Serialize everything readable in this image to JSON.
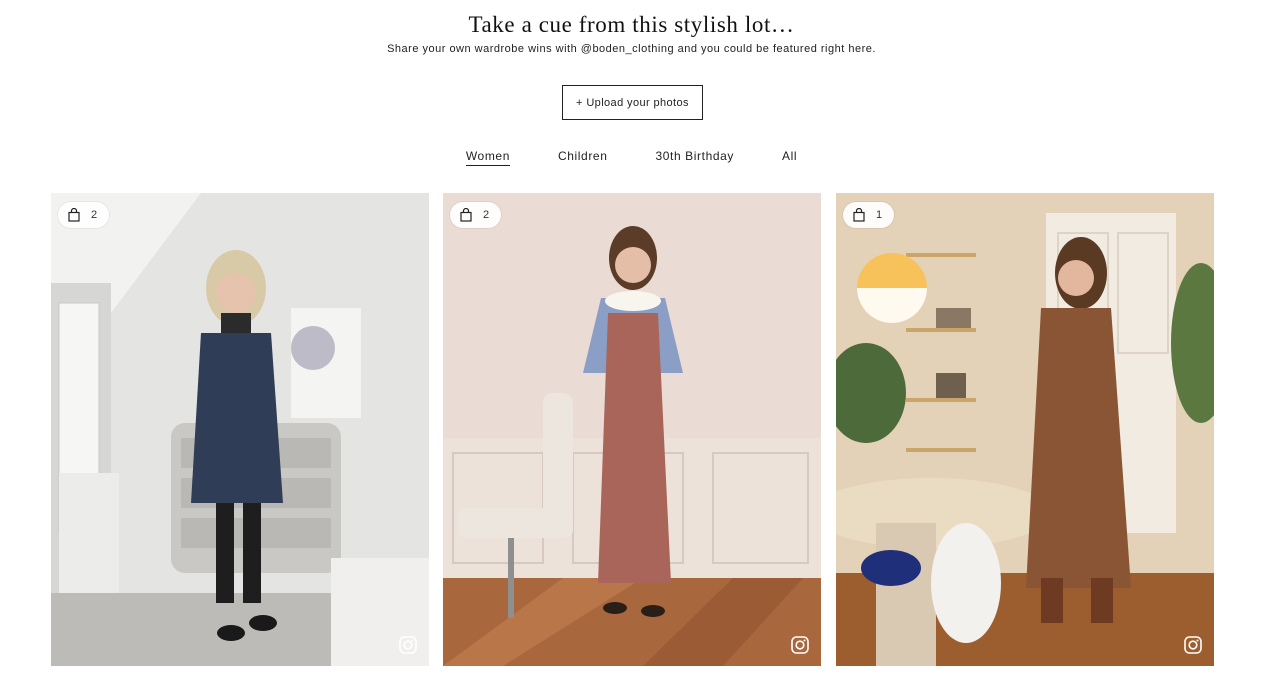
{
  "header": {
    "title": "Take a cue from this stylish lot…",
    "subtitle": "Share your own wardrobe wins with @boden_clothing and you could be featured right here."
  },
  "upload_button": {
    "label": "+ Upload your photos"
  },
  "tabs": [
    {
      "label": "Women",
      "active": true
    },
    {
      "label": "Children",
      "active": false
    },
    {
      "label": "30th Birthday",
      "active": false
    },
    {
      "label": "All",
      "active": false
    }
  ],
  "gallery": {
    "cards": [
      {
        "product_count": "2",
        "icons": [
          "shopping-bag-icon",
          "instagram-icon"
        ]
      },
      {
        "product_count": "2",
        "icons": [
          "shopping-bag-icon",
          "instagram-icon"
        ]
      },
      {
        "product_count": "1",
        "icons": [
          "shopping-bag-icon",
          "instagram-icon"
        ]
      }
    ]
  },
  "colors": {
    "text": "#1a1a1a",
    "background": "#ffffff",
    "border": "#222222"
  }
}
